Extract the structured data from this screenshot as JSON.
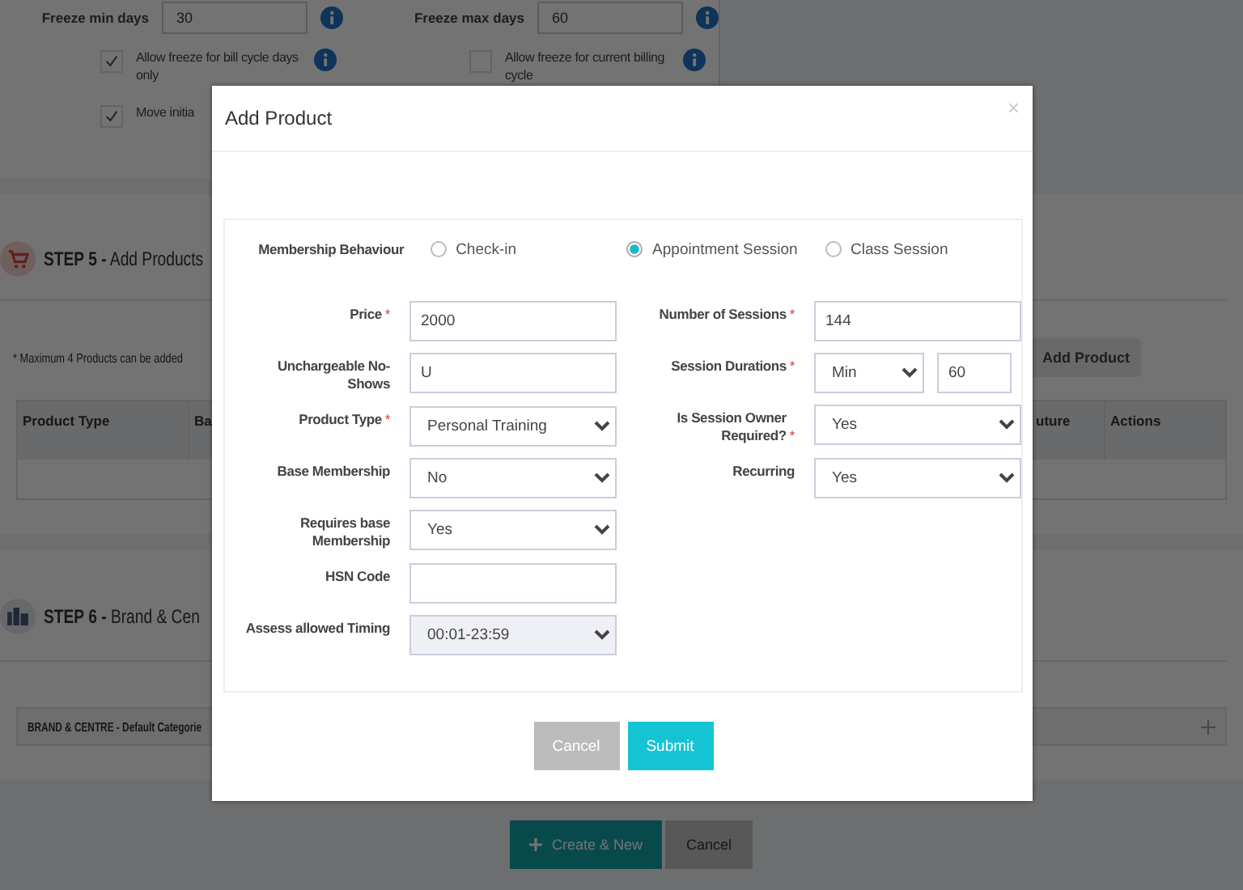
{
  "background": {
    "freeze_fields": [
      {
        "label": "Freeze min days",
        "value": "30"
      },
      {
        "label": "Freeze max days",
        "value": "60"
      }
    ],
    "options": [
      {
        "label": "Allow freeze for bill cycle days only",
        "checked": true,
        "info": true
      },
      {
        "label": "Allow freeze for current billing cycle",
        "checked": false,
        "info": true
      },
      {
        "label": "Move initia",
        "checked": true,
        "info": false
      }
    ],
    "step5": {
      "step": "STEP 5 -",
      "title": "Add Products",
      "note": "* Maximum 4 Products can be added",
      "button": "Add Product",
      "columns": [
        "Product Type",
        "Ba",
        "uture",
        "Actions"
      ]
    },
    "step6": {
      "step": "STEP 6 -",
      "title": "Brand & Cen",
      "row": "BRAND & CENTRE - Default Categorie"
    },
    "buttons": [
      {
        "label": "Create & New",
        "kind": "primary"
      },
      {
        "label": "Cancel",
        "kind": "secondary"
      }
    ]
  },
  "modal": {
    "title": "Add Product",
    "close": "×",
    "behaviour": {
      "label": "Membership Behaviour",
      "options": [
        {
          "label": "Check-in",
          "selected": false
        },
        {
          "label": "Appointment Session",
          "selected": true
        },
        {
          "label": "Class Session",
          "selected": false
        }
      ]
    },
    "left_fields": [
      {
        "label": "Price",
        "mark": "*",
        "kind": "input",
        "value": "2000",
        "disabled": false
      },
      {
        "label": "Unchargeable No-Shows",
        "kind": "input",
        "value": "U",
        "disabled": false
      },
      {
        "label": "Product Type",
        "mark": "*",
        "kind": "select",
        "value": "Personal Training",
        "disabled": false
      },
      {
        "label": "Base Membership",
        "kind": "select",
        "value": "No",
        "disabled": false
      },
      {
        "label": "Requires base Membership",
        "kind": "select",
        "value": "Yes",
        "disabled": false
      },
      {
        "label": "HSN Code",
        "kind": "input",
        "disabled": false
      },
      {
        "label": "Assess allowed Timing",
        "kind": "select",
        "value": "00:01-23:59",
        "disabled": true
      }
    ],
    "right_fields": [
      {
        "label": "Number of Sessions",
        "mark": "*",
        "kind": "input",
        "value": "144",
        "disabled": false
      },
      {
        "label": "Session Durations",
        "mark": "*",
        "kind": "duration",
        "unit": "Min",
        "value": "60",
        "disabled": false
      },
      {
        "label": "Is Session Owner Required?",
        "mark": "*",
        "kind": "select",
        "value": "Yes",
        "disabled": false
      },
      {
        "label": "Recurring",
        "kind": "select",
        "value": "Yes",
        "disabled": false
      }
    ],
    "buttons": [
      {
        "label": "Cancel",
        "kind": "secondary"
      },
      {
        "label": "Submit",
        "kind": "primary"
      }
    ]
  }
}
